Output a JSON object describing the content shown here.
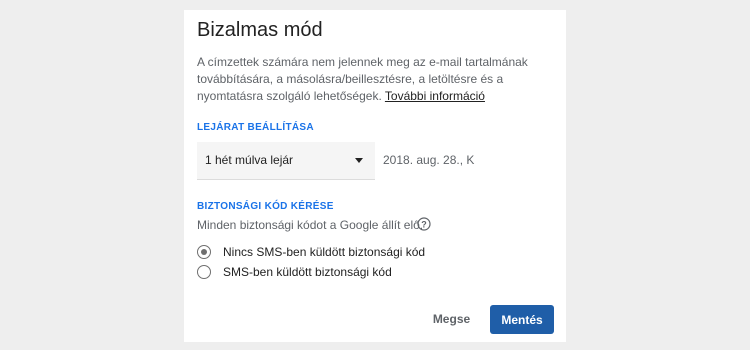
{
  "dialog": {
    "title": "Bizalmas mód",
    "description": "A címzettek számára nem jelennek meg az e-mail tartalmának továbbítására, a másolásra/beillesztésre, a letöltésre és a nyomtatásra szolgáló lehetőségek. ",
    "more_info_link": "További információ"
  },
  "expiry": {
    "section_label": "LEJÁRAT BEÁLLÍTÁSA",
    "selected_option": "1 hét múlva lejár",
    "date": "2018. aug. 28., K"
  },
  "security_code": {
    "section_label": "BIZTONSÁGI KÓD KÉRÉSE",
    "description": "Minden biztonsági kódot a Google állít elő.",
    "options": [
      {
        "label": "Nincs SMS-ben küldött biztonsági kód",
        "checked": true
      },
      {
        "label": "SMS-ben küldött biztonsági kód",
        "checked": false
      }
    ]
  },
  "buttons": {
    "cancel": "Megse",
    "save": "Mentés"
  },
  "colors": {
    "accent": "#1a73e8",
    "primary_button": "#1f5ea8",
    "background": "#eeeeee"
  },
  "icons": {
    "help": "help-icon",
    "dropdown": "caret-down-icon"
  }
}
